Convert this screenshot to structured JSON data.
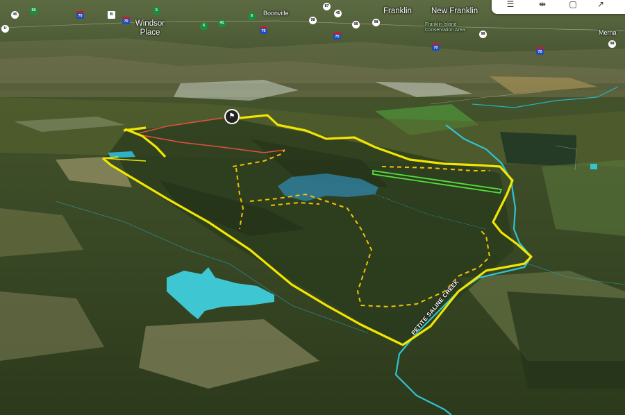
{
  "places": {
    "windsor_place": "Windsor\nPlace",
    "boonville": "Boonville",
    "franklin": "Franklin",
    "new_franklin": "New Franklin",
    "franklin_island": "Franklin Island\nConservation Area",
    "merna": "Merna"
  },
  "creek": {
    "label": "PETITE SALINE CREEK"
  },
  "shields": [
    {
      "kind": "state",
      "text": "U"
    },
    {
      "kind": "state",
      "text": "45"
    },
    {
      "kind": "green",
      "text": "50"
    },
    {
      "kind": "interstate",
      "text": "70"
    },
    {
      "kind": "us",
      "text": "B"
    },
    {
      "kind": "green",
      "text": "5"
    },
    {
      "kind": "interstate",
      "text": "70"
    },
    {
      "kind": "green",
      "text": "5"
    },
    {
      "kind": "green",
      "text": "41"
    },
    {
      "kind": "green",
      "text": "5"
    },
    {
      "kind": "interstate",
      "text": "70"
    },
    {
      "kind": "state",
      "text": "87"
    },
    {
      "kind": "state",
      "text": "45"
    },
    {
      "kind": "state",
      "text": "98"
    },
    {
      "kind": "state",
      "text": "98"
    },
    {
      "kind": "interstate",
      "text": "70"
    },
    {
      "kind": "state",
      "text": "98"
    },
    {
      "kind": "state",
      "text": "98"
    },
    {
      "kind": "interstate",
      "text": "70"
    },
    {
      "kind": "interstate",
      "text": "70"
    },
    {
      "kind": "state",
      "text": "98"
    }
  ],
  "toolbar": {
    "icons": [
      "layers-icon",
      "ruler-icon",
      "square-icon",
      "share-icon"
    ]
  },
  "colors": {
    "boundary": "#f2e600",
    "trail": "#f5c400",
    "creek": "#2fc4d6",
    "pond": "#3ec6d2",
    "red_line": "#e0503c",
    "green_line": "#53e03b"
  }
}
